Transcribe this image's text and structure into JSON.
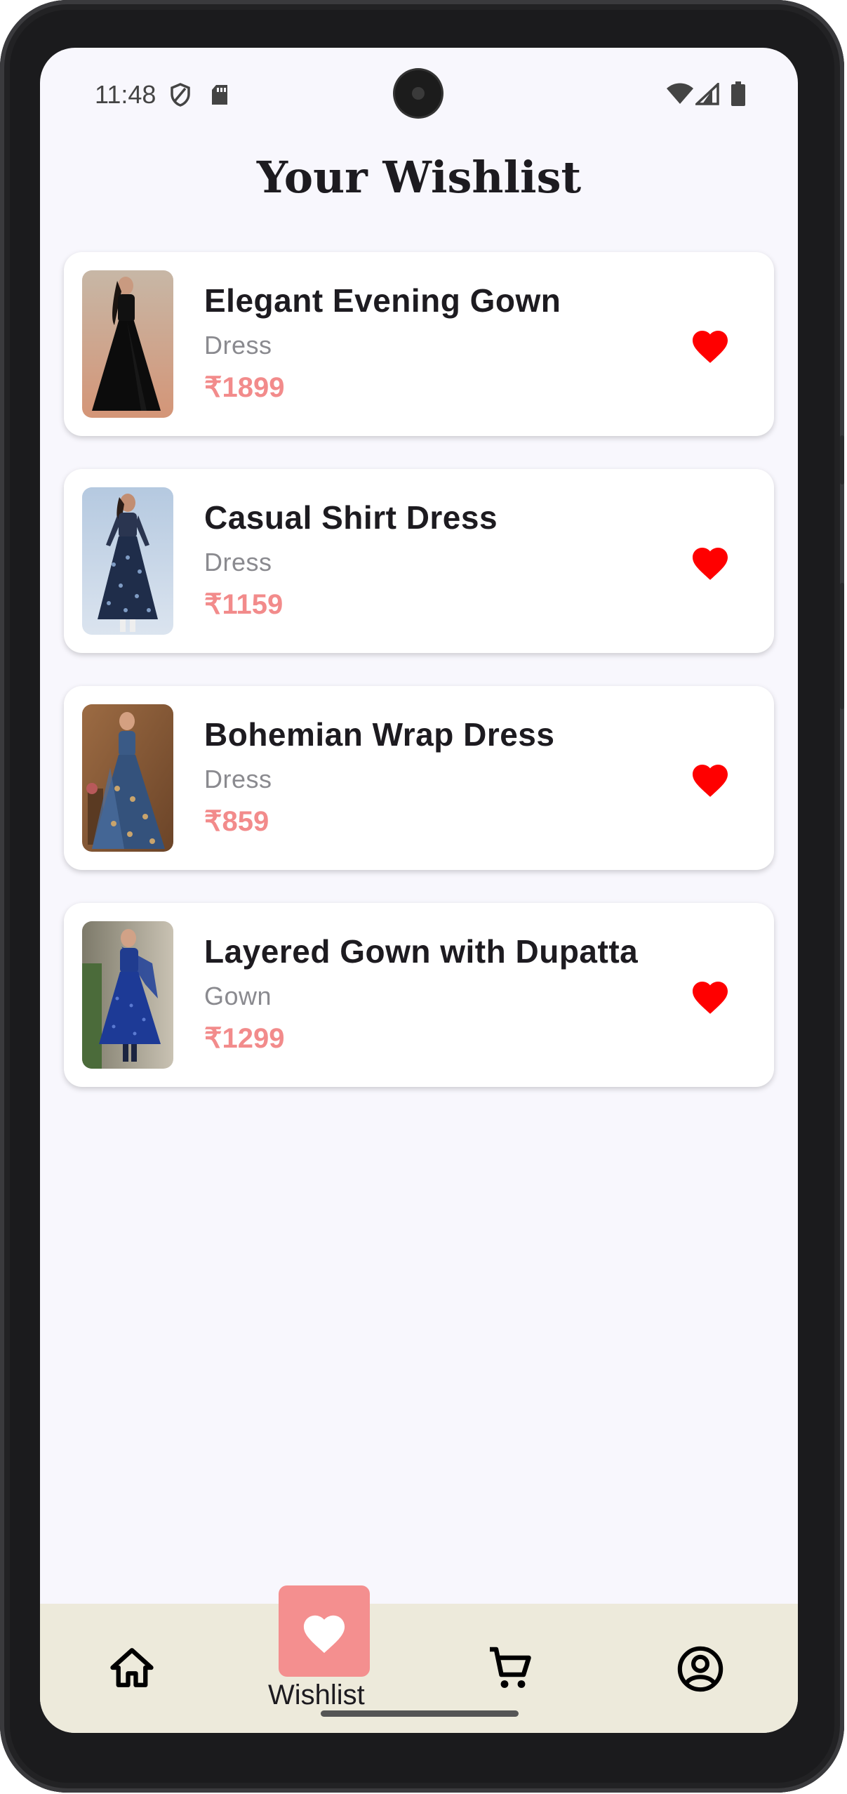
{
  "status_bar": {
    "time": "11:48"
  },
  "page": {
    "title": "Your Wishlist"
  },
  "wishlist": [
    {
      "name": "Elegant Evening Gown",
      "category": "Dress",
      "price": "₹1899",
      "image": "woman-black-gown"
    },
    {
      "name": "Casual Shirt Dress",
      "category": "Dress",
      "price": "₹1159",
      "image": "woman-navy-print-dress"
    },
    {
      "name": "Bohemian Wrap Dress",
      "category": "Dress",
      "price": "₹859",
      "image": "woman-blue-embroidered-gown"
    },
    {
      "name": "Layered Gown with Dupatta",
      "category": "Gown",
      "price": "₹1299",
      "image": "woman-blue-gown-dupatta"
    }
  ],
  "bottom_nav": {
    "items": [
      {
        "icon": "home-icon",
        "label": ""
      },
      {
        "icon": "heart-icon",
        "label": "Wishlist",
        "active": true
      },
      {
        "icon": "cart-icon",
        "label": ""
      },
      {
        "icon": "account-icon",
        "label": ""
      }
    ]
  },
  "colors": {
    "accent": "#f48f8f",
    "price": "#f28b8b",
    "heart": "#ff0000",
    "nav_bg": "#edeadb",
    "screen_bg": "#f8f7fd"
  }
}
